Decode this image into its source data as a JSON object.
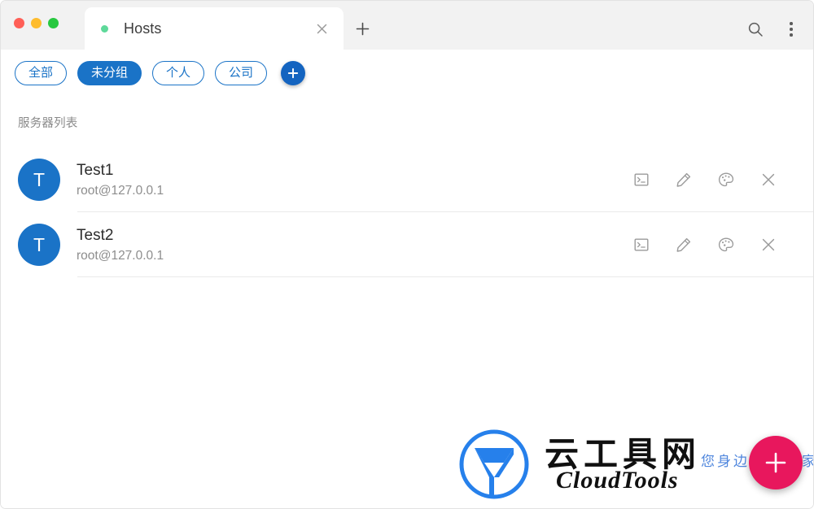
{
  "window": {
    "traffic_lights": [
      {
        "name": "close",
        "color": "#ff5f57"
      },
      {
        "name": "minimize",
        "color": "#febc2e"
      },
      {
        "name": "maximize",
        "color": "#28c840"
      }
    ]
  },
  "tabs": [
    {
      "title": "Hosts",
      "status_color": "#5ed99a",
      "active": true
    }
  ],
  "titlebar_actions": {
    "new_tab_icon": "plus-icon",
    "search_icon": "search-icon",
    "menu_icon": "more-vertical-icon"
  },
  "filters": {
    "chips": [
      {
        "label": "全部",
        "active": false
      },
      {
        "label": "未分组",
        "active": true
      },
      {
        "label": "个人",
        "active": false
      },
      {
        "label": "公司",
        "active": false
      }
    ],
    "add_icon": "plus-icon",
    "accent": "#1a73c7"
  },
  "main": {
    "section_title": "服务器列表",
    "servers": [
      {
        "avatar_letter": "T",
        "name": "Test1",
        "connection": "root@127.0.0.1"
      },
      {
        "avatar_letter": "T",
        "name": "Test2",
        "connection": "root@127.0.0.1"
      }
    ],
    "row_actions": [
      {
        "name": "terminal-icon",
        "title": "Terminal"
      },
      {
        "name": "edit-icon",
        "title": "Edit"
      },
      {
        "name": "palette-icon",
        "title": "Theme"
      },
      {
        "name": "close-icon",
        "title": "Delete"
      }
    ]
  },
  "watermark": {
    "cn_title": "云工具网",
    "en_title": "CloudTools",
    "slogan": "您身边的IT专家",
    "logo_letter": "y",
    "logo_color": "#2680eb",
    "slogan_color": "#4f86dd"
  },
  "fab": {
    "icon": "plus-icon",
    "color": "#e8175d"
  }
}
